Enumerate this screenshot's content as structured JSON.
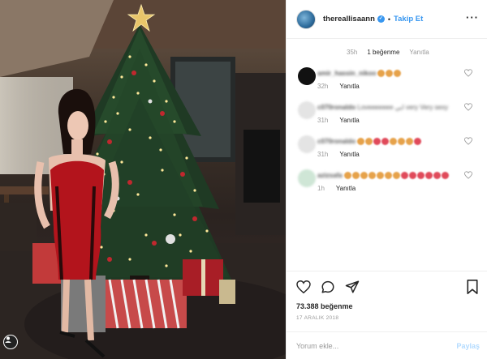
{
  "header": {
    "username": "thereallisaann",
    "separator": "•",
    "follow_label": "Takip Et",
    "more_label": "···"
  },
  "first_comment_meta": {
    "time": "35h",
    "likes": "1 beğenme",
    "reply": "Yanıtla"
  },
  "comments": [
    {
      "user": "amir_hassin_nikoo",
      "text": "",
      "emojis": [
        "#e6a24a",
        "#e6a24a",
        "#e6a24a"
      ],
      "time": "32h",
      "reply": "Yanıtla",
      "avatar_color": "#111111"
    },
    {
      "user": "c070ronaldo",
      "text": "Loveeeeeee ابي very Very sexy",
      "emojis": [],
      "time": "31h",
      "reply": "Yanıtla",
      "avatar_color": "#e4e4e4"
    },
    {
      "user": "c070ronaldo",
      "text": "",
      "emojis": [
        "#e6a24a",
        "#e6a24a",
        "#e04a5a",
        "#e04a5a",
        "#e6a24a",
        "#e6a24a",
        "#e6a24a",
        "#e04a5a"
      ],
      "time": "31h",
      "reply": "Yanıtla",
      "avatar_color": "#e4e4e4"
    },
    {
      "user": "azizsafa",
      "text": "",
      "emojis": [
        "#e6a24a",
        "#e6a24a",
        "#e6a24a",
        "#e6a24a",
        "#e6a24a",
        "#e6a24a",
        "#e6a24a",
        "#e04a5a",
        "#e04a5a",
        "#e04a5a",
        "#e04a5a",
        "#e04a5a",
        "#e04a5a"
      ],
      "time": "1h",
      "reply": "Yanıtla",
      "avatar_color": "#cfe6d6"
    }
  ],
  "actions": {
    "likes": "73.388 beğenme",
    "date": "17 ARALIK 2018"
  },
  "add_comment": {
    "placeholder": "Yorum ekle...",
    "post_label": "Paylaş"
  },
  "colors": {
    "link_blue": "#3897f0",
    "muted": "#999999",
    "border": "#efefef"
  }
}
